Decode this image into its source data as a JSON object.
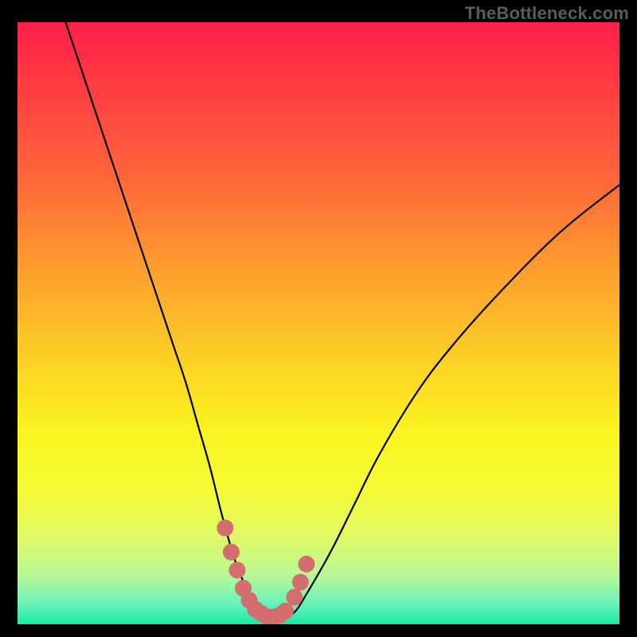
{
  "watermark": {
    "text": "TheBottleneck.com"
  },
  "colors": {
    "background": "#000000",
    "gradient_stops": [
      {
        "offset": 0.0,
        "color": "#ff1f4b"
      },
      {
        "offset": 0.1,
        "color": "#ff3b42"
      },
      {
        "offset": 0.25,
        "color": "#fe633b"
      },
      {
        "offset": 0.4,
        "color": "#fd9a2e"
      },
      {
        "offset": 0.55,
        "color": "#fccd26"
      },
      {
        "offset": 0.68,
        "color": "#faf41f"
      },
      {
        "offset": 0.78,
        "color": "#f4fb37"
      },
      {
        "offset": 0.86,
        "color": "#dff86a"
      },
      {
        "offset": 0.92,
        "color": "#b7f797"
      },
      {
        "offset": 0.965,
        "color": "#6bf3b8"
      },
      {
        "offset": 1.0,
        "color": "#18eaa2"
      }
    ],
    "curve": "#000000",
    "marker_fill": "#d46e6e",
    "marker_stroke": "#c45a5a"
  },
  "chart_data": {
    "type": "line",
    "title": "",
    "xlabel": "",
    "ylabel": "",
    "xlim": [
      0,
      100
    ],
    "ylim": [
      0,
      100
    ],
    "grid": false,
    "legend": false,
    "series": [
      {
        "name": "bottleneck-curve",
        "x": [
          8,
          12,
          16,
          20,
          24,
          26,
          28,
          30,
          32,
          34,
          36,
          38,
          40,
          42,
          44,
          46,
          48,
          52,
          56,
          60,
          66,
          72,
          80,
          90,
          100
        ],
        "y": [
          100,
          88,
          76,
          64,
          52,
          46,
          40,
          33,
          26,
          18,
          11,
          6,
          2,
          1,
          1,
          2,
          5,
          12,
          20,
          28,
          38,
          46,
          55,
          65,
          73
        ]
      }
    ],
    "markers": {
      "name": "highlight-band",
      "x": [
        34.5,
        35.5,
        36.5,
        37.5,
        38.5,
        39.5,
        40.5,
        41.5,
        42.5,
        43.5,
        44.5,
        46.0,
        47.0,
        48.0
      ],
      "y": [
        16,
        12,
        9,
        6,
        4,
        2.5,
        1.8,
        1.2,
        1.2,
        1.5,
        2.2,
        4.5,
        7,
        10
      ]
    }
  }
}
